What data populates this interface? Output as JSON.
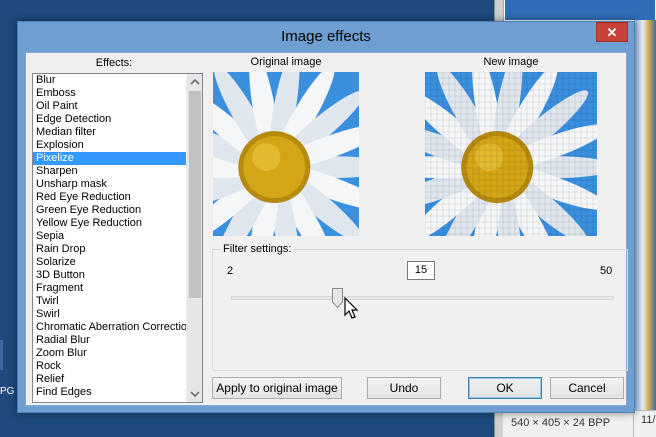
{
  "dialog": {
    "title": "Image effects",
    "close_glyph": "✕"
  },
  "effects": {
    "label": "Effects:",
    "items": [
      "Blur",
      "Emboss",
      "Oil Paint",
      "Edge Detection",
      "Median filter",
      "Explosion",
      "Pixelize",
      "Sharpen",
      "Unsharp mask",
      "Red Eye Reduction",
      "Green Eye Reduction",
      "Yellow Eye Reduction",
      "Sepia",
      "Rain Drop",
      "Solarize",
      "3D Button",
      "Fragment",
      "Twirl",
      "Swirl",
      "Chromatic Aberration Correction",
      "Radial Blur",
      "Zoom Blur",
      "Rock",
      "Relief",
      "Find Edges"
    ],
    "selected_index": 6
  },
  "preview": {
    "original_title": "Original image",
    "new_title": "New image"
  },
  "filter": {
    "group_label": "Filter settings:",
    "min": "2",
    "max": "50",
    "value": "15"
  },
  "buttons": {
    "apply": "Apply to original image",
    "undo": "Undo",
    "ok": "OK",
    "cancel": "Cancel"
  },
  "background": {
    "left_label": "PG",
    "status_text": "540 × 405 × 24 BPP",
    "status_right": "11/"
  },
  "colors": {
    "selection": "#3399ff",
    "close": "#c7433a",
    "sky": "#3a8fde",
    "petal": "#f4f6f8",
    "center": "#d4a516"
  },
  "icons": {
    "close": "close-icon",
    "scroll_up": "chevron-up-icon",
    "scroll_down": "chevron-down-icon",
    "cursor": "mouse-pointer-icon"
  }
}
